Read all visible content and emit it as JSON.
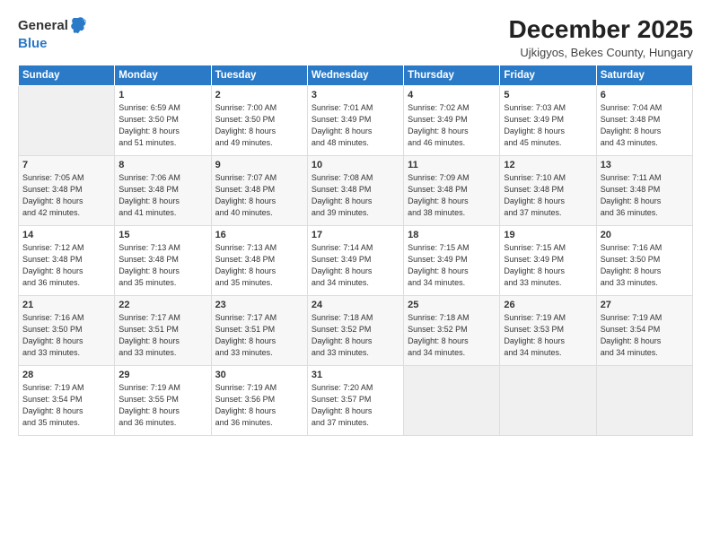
{
  "logo": {
    "general": "General",
    "blue": "Blue"
  },
  "title": "December 2025",
  "subtitle": "Ujkigyos, Bekes County, Hungary",
  "days_header": [
    "Sunday",
    "Monday",
    "Tuesday",
    "Wednesday",
    "Thursday",
    "Friday",
    "Saturday"
  ],
  "weeks": [
    [
      {
        "day": "",
        "info": ""
      },
      {
        "day": "1",
        "info": "Sunrise: 6:59 AM\nSunset: 3:50 PM\nDaylight: 8 hours\nand 51 minutes."
      },
      {
        "day": "2",
        "info": "Sunrise: 7:00 AM\nSunset: 3:50 PM\nDaylight: 8 hours\nand 49 minutes."
      },
      {
        "day": "3",
        "info": "Sunrise: 7:01 AM\nSunset: 3:49 PM\nDaylight: 8 hours\nand 48 minutes."
      },
      {
        "day": "4",
        "info": "Sunrise: 7:02 AM\nSunset: 3:49 PM\nDaylight: 8 hours\nand 46 minutes."
      },
      {
        "day": "5",
        "info": "Sunrise: 7:03 AM\nSunset: 3:49 PM\nDaylight: 8 hours\nand 45 minutes."
      },
      {
        "day": "6",
        "info": "Sunrise: 7:04 AM\nSunset: 3:48 PM\nDaylight: 8 hours\nand 43 minutes."
      }
    ],
    [
      {
        "day": "7",
        "info": "Sunrise: 7:05 AM\nSunset: 3:48 PM\nDaylight: 8 hours\nand 42 minutes."
      },
      {
        "day": "8",
        "info": "Sunrise: 7:06 AM\nSunset: 3:48 PM\nDaylight: 8 hours\nand 41 minutes."
      },
      {
        "day": "9",
        "info": "Sunrise: 7:07 AM\nSunset: 3:48 PM\nDaylight: 8 hours\nand 40 minutes."
      },
      {
        "day": "10",
        "info": "Sunrise: 7:08 AM\nSunset: 3:48 PM\nDaylight: 8 hours\nand 39 minutes."
      },
      {
        "day": "11",
        "info": "Sunrise: 7:09 AM\nSunset: 3:48 PM\nDaylight: 8 hours\nand 38 minutes."
      },
      {
        "day": "12",
        "info": "Sunrise: 7:10 AM\nSunset: 3:48 PM\nDaylight: 8 hours\nand 37 minutes."
      },
      {
        "day": "13",
        "info": "Sunrise: 7:11 AM\nSunset: 3:48 PM\nDaylight: 8 hours\nand 36 minutes."
      }
    ],
    [
      {
        "day": "14",
        "info": "Sunrise: 7:12 AM\nSunset: 3:48 PM\nDaylight: 8 hours\nand 36 minutes."
      },
      {
        "day": "15",
        "info": "Sunrise: 7:13 AM\nSunset: 3:48 PM\nDaylight: 8 hours\nand 35 minutes."
      },
      {
        "day": "16",
        "info": "Sunrise: 7:13 AM\nSunset: 3:48 PM\nDaylight: 8 hours\nand 35 minutes."
      },
      {
        "day": "17",
        "info": "Sunrise: 7:14 AM\nSunset: 3:49 PM\nDaylight: 8 hours\nand 34 minutes."
      },
      {
        "day": "18",
        "info": "Sunrise: 7:15 AM\nSunset: 3:49 PM\nDaylight: 8 hours\nand 34 minutes."
      },
      {
        "day": "19",
        "info": "Sunrise: 7:15 AM\nSunset: 3:49 PM\nDaylight: 8 hours\nand 33 minutes."
      },
      {
        "day": "20",
        "info": "Sunrise: 7:16 AM\nSunset: 3:50 PM\nDaylight: 8 hours\nand 33 minutes."
      }
    ],
    [
      {
        "day": "21",
        "info": "Sunrise: 7:16 AM\nSunset: 3:50 PM\nDaylight: 8 hours\nand 33 minutes."
      },
      {
        "day": "22",
        "info": "Sunrise: 7:17 AM\nSunset: 3:51 PM\nDaylight: 8 hours\nand 33 minutes."
      },
      {
        "day": "23",
        "info": "Sunrise: 7:17 AM\nSunset: 3:51 PM\nDaylight: 8 hours\nand 33 minutes."
      },
      {
        "day": "24",
        "info": "Sunrise: 7:18 AM\nSunset: 3:52 PM\nDaylight: 8 hours\nand 33 minutes."
      },
      {
        "day": "25",
        "info": "Sunrise: 7:18 AM\nSunset: 3:52 PM\nDaylight: 8 hours\nand 34 minutes."
      },
      {
        "day": "26",
        "info": "Sunrise: 7:19 AM\nSunset: 3:53 PM\nDaylight: 8 hours\nand 34 minutes."
      },
      {
        "day": "27",
        "info": "Sunrise: 7:19 AM\nSunset: 3:54 PM\nDaylight: 8 hours\nand 34 minutes."
      }
    ],
    [
      {
        "day": "28",
        "info": "Sunrise: 7:19 AM\nSunset: 3:54 PM\nDaylight: 8 hours\nand 35 minutes."
      },
      {
        "day": "29",
        "info": "Sunrise: 7:19 AM\nSunset: 3:55 PM\nDaylight: 8 hours\nand 36 minutes."
      },
      {
        "day": "30",
        "info": "Sunrise: 7:19 AM\nSunset: 3:56 PM\nDaylight: 8 hours\nand 36 minutes."
      },
      {
        "day": "31",
        "info": "Sunrise: 7:20 AM\nSunset: 3:57 PM\nDaylight: 8 hours\nand 37 minutes."
      },
      {
        "day": "",
        "info": ""
      },
      {
        "day": "",
        "info": ""
      },
      {
        "day": "",
        "info": ""
      }
    ]
  ]
}
